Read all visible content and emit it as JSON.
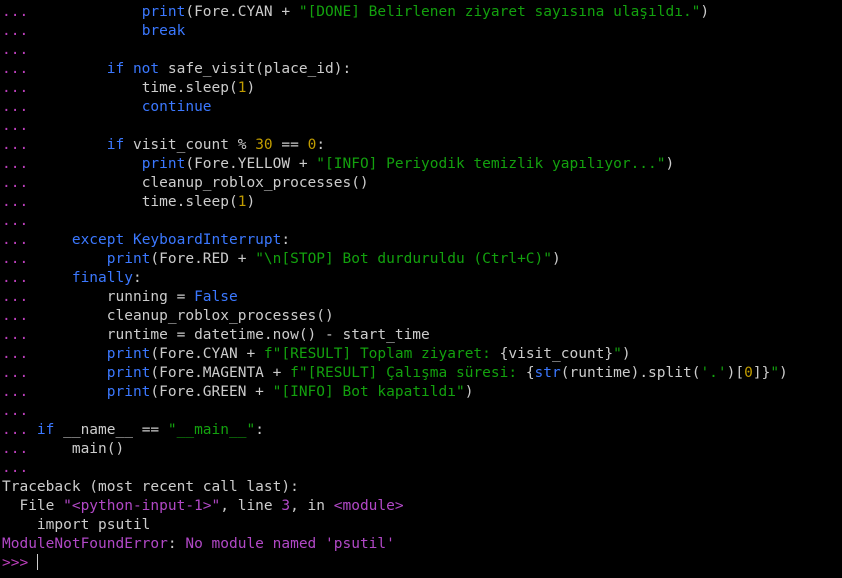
{
  "colors": {
    "background": "#000000",
    "text": "#cccccc",
    "prompt": "#bc3fbc",
    "keyword_blue": "#3b78ff",
    "keyword_cyan": "#3b9ad6",
    "string_green": "#13a10e",
    "number_yellow": "#c19c00",
    "error_magenta": "#b148c6"
  },
  "terminal": {
    "lines": [
      {
        "segments": [
          {
            "text": "...             ",
            "c": "prompt"
          },
          {
            "text": "print",
            "c": "keyword_blue"
          },
          {
            "text": "(Fore.CYAN + ",
            "c": "text"
          },
          {
            "text": "\"[DONE] Belirlenen ziyaret sayısına ulaşıldı.\"",
            "c": "string_green"
          },
          {
            "text": ")",
            "c": "text"
          }
        ]
      },
      {
        "segments": [
          {
            "text": "...             ",
            "c": "prompt"
          },
          {
            "text": "break",
            "c": "keyword_blue"
          }
        ]
      },
      {
        "segments": [
          {
            "text": "...",
            "c": "prompt"
          }
        ]
      },
      {
        "segments": [
          {
            "text": "...         ",
            "c": "prompt"
          },
          {
            "text": "if not",
            "c": "keyword_blue"
          },
          {
            "text": " safe_visit(place_id):",
            "c": "text"
          }
        ]
      },
      {
        "segments": [
          {
            "text": "...             ",
            "c": "prompt"
          },
          {
            "text": "time.sleep(",
            "c": "text"
          },
          {
            "text": "1",
            "c": "number_yellow"
          },
          {
            "text": ")",
            "c": "text"
          }
        ]
      },
      {
        "segments": [
          {
            "text": "...             ",
            "c": "prompt"
          },
          {
            "text": "continue",
            "c": "keyword_blue"
          }
        ]
      },
      {
        "segments": [
          {
            "text": "...",
            "c": "prompt"
          }
        ]
      },
      {
        "segments": [
          {
            "text": "...         ",
            "c": "prompt"
          },
          {
            "text": "if",
            "c": "keyword_blue"
          },
          {
            "text": " visit_count % ",
            "c": "text"
          },
          {
            "text": "30",
            "c": "number_yellow"
          },
          {
            "text": " == ",
            "c": "text"
          },
          {
            "text": "0",
            "c": "number_yellow"
          },
          {
            "text": ":",
            "c": "text"
          }
        ]
      },
      {
        "segments": [
          {
            "text": "...             ",
            "c": "prompt"
          },
          {
            "text": "print",
            "c": "keyword_blue"
          },
          {
            "text": "(Fore.YELLOW + ",
            "c": "text"
          },
          {
            "text": "\"[INFO] Periyodik temizlik yapılıyor...\"",
            "c": "string_green"
          },
          {
            "text": ")",
            "c": "text"
          }
        ]
      },
      {
        "segments": [
          {
            "text": "...             ",
            "c": "prompt"
          },
          {
            "text": "cleanup_roblox_processes()",
            "c": "text"
          }
        ]
      },
      {
        "segments": [
          {
            "text": "...             ",
            "c": "prompt"
          },
          {
            "text": "time.sleep(",
            "c": "text"
          },
          {
            "text": "1",
            "c": "number_yellow"
          },
          {
            "text": ")",
            "c": "text"
          }
        ]
      },
      {
        "segments": [
          {
            "text": "...",
            "c": "prompt"
          }
        ]
      },
      {
        "segments": [
          {
            "text": "...     ",
            "c": "prompt"
          },
          {
            "text": "except",
            "c": "keyword_blue"
          },
          {
            "text": " ",
            "c": "text"
          },
          {
            "text": "KeyboardInterrupt",
            "c": "keyword_blue"
          },
          {
            "text": ":",
            "c": "text"
          }
        ]
      },
      {
        "segments": [
          {
            "text": "...         ",
            "c": "prompt"
          },
          {
            "text": "print",
            "c": "keyword_blue"
          },
          {
            "text": "(Fore.RED + ",
            "c": "text"
          },
          {
            "text": "\"\\n[STOP] Bot durduruldu (Ctrl+C)\"",
            "c": "string_green"
          },
          {
            "text": ")",
            "c": "text"
          }
        ]
      },
      {
        "segments": [
          {
            "text": "...     ",
            "c": "prompt"
          },
          {
            "text": "finally",
            "c": "keyword_blue"
          },
          {
            "text": ":",
            "c": "text"
          }
        ]
      },
      {
        "segments": [
          {
            "text": "...         ",
            "c": "prompt"
          },
          {
            "text": "running = ",
            "c": "text"
          },
          {
            "text": "False",
            "c": "keyword_blue"
          }
        ]
      },
      {
        "segments": [
          {
            "text": "...         ",
            "c": "prompt"
          },
          {
            "text": "cleanup_roblox_processes()",
            "c": "text"
          }
        ]
      },
      {
        "segments": [
          {
            "text": "...         ",
            "c": "prompt"
          },
          {
            "text": "runtime = datetime.now() - start_time",
            "c": "text"
          }
        ]
      },
      {
        "segments": [
          {
            "text": "...         ",
            "c": "prompt"
          },
          {
            "text": "print",
            "c": "keyword_blue"
          },
          {
            "text": "(Fore.CYAN + ",
            "c": "text"
          },
          {
            "text": "f\"[RESULT] Toplam ziyaret: ",
            "c": "string_green"
          },
          {
            "text": "{visit_count}",
            "c": "text"
          },
          {
            "text": "\"",
            "c": "string_green"
          },
          {
            "text": ")",
            "c": "text"
          }
        ]
      },
      {
        "segments": [
          {
            "text": "...         ",
            "c": "prompt"
          },
          {
            "text": "print",
            "c": "keyword_blue"
          },
          {
            "text": "(Fore.MAGENTA + ",
            "c": "text"
          },
          {
            "text": "f\"[RESULT] Çalışma süresi: ",
            "c": "string_green"
          },
          {
            "text": "{",
            "c": "text"
          },
          {
            "text": "str",
            "c": "keyword_blue"
          },
          {
            "text": "(runtime).split(",
            "c": "text"
          },
          {
            "text": "'.'",
            "c": "string_green"
          },
          {
            "text": ")[",
            "c": "text"
          },
          {
            "text": "0",
            "c": "number_yellow"
          },
          {
            "text": "]}",
            "c": "text"
          },
          {
            "text": "\"",
            "c": "string_green"
          },
          {
            "text": ")",
            "c": "text"
          }
        ]
      },
      {
        "segments": [
          {
            "text": "...         ",
            "c": "prompt"
          },
          {
            "text": "print",
            "c": "keyword_blue"
          },
          {
            "text": "(Fore.GREEN + ",
            "c": "text"
          },
          {
            "text": "\"[INFO] Bot kapatıldı\"",
            "c": "string_green"
          },
          {
            "text": ")",
            "c": "text"
          }
        ]
      },
      {
        "segments": [
          {
            "text": "...",
            "c": "prompt"
          }
        ]
      },
      {
        "segments": [
          {
            "text": "... ",
            "c": "prompt"
          },
          {
            "text": "if",
            "c": "keyword_blue"
          },
          {
            "text": " __name__ == ",
            "c": "text"
          },
          {
            "text": "\"__main__\"",
            "c": "string_green"
          },
          {
            "text": ":",
            "c": "text"
          }
        ]
      },
      {
        "segments": [
          {
            "text": "...     ",
            "c": "prompt"
          },
          {
            "text": "main()",
            "c": "text"
          }
        ]
      },
      {
        "segments": [
          {
            "text": "...",
            "c": "prompt"
          }
        ]
      },
      {
        "segments": [
          {
            "text": "Traceback (most recent call last):",
            "c": "text"
          }
        ]
      },
      {
        "segments": [
          {
            "text": "  File ",
            "c": "text"
          },
          {
            "text": "\"<python-input-1>\"",
            "c": "error_magenta"
          },
          {
            "text": ", line ",
            "c": "text"
          },
          {
            "text": "3",
            "c": "error_magenta"
          },
          {
            "text": ", in ",
            "c": "text"
          },
          {
            "text": "<module>",
            "c": "error_magenta"
          }
        ]
      },
      {
        "segments": [
          {
            "text": "    import psutil",
            "c": "text"
          }
        ]
      },
      {
        "segments": [
          {
            "text": "ModuleNotFoundError",
            "c": "error_magenta"
          },
          {
            "text": ": ",
            "c": "text"
          },
          {
            "text": "No module named 'psutil'",
            "c": "error_magenta"
          }
        ]
      },
      {
        "segments": [
          {
            "text": ">>> ",
            "c": "prompt"
          }
        ],
        "cursor": true
      }
    ]
  }
}
